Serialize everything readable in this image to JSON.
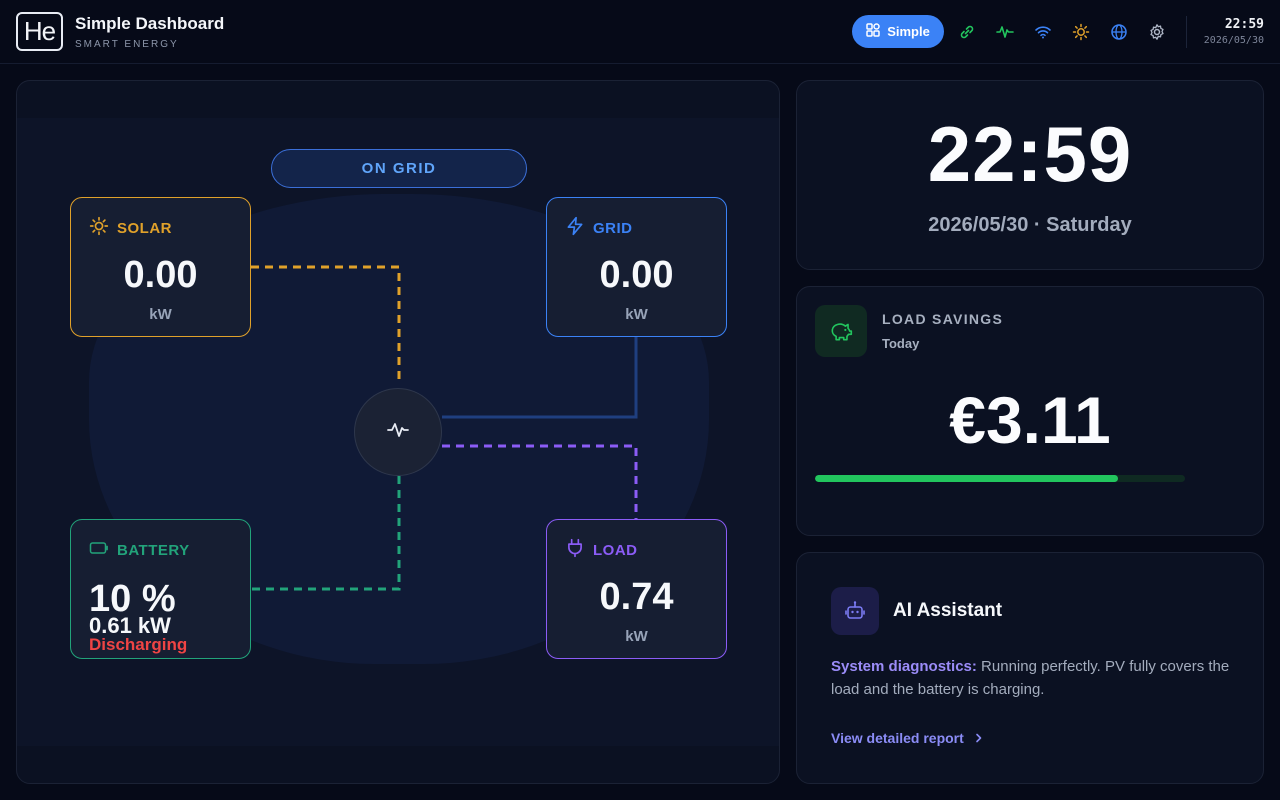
{
  "header": {
    "logo_text": "He",
    "title": "Simple Dashboard",
    "subtitle": "SMART ENERGY",
    "mode_button": "Simple",
    "time": "22:59",
    "date": "2026/05/30",
    "icons": [
      "link-icon",
      "pulse-icon",
      "wifi-icon",
      "sun-icon",
      "globe-icon",
      "gear-icon"
    ]
  },
  "flow": {
    "status": "ON GRID",
    "solar": {
      "label": "SOLAR",
      "value": "0.00",
      "unit": "kW"
    },
    "grid": {
      "label": "GRID",
      "value": "0.00",
      "unit": "kW"
    },
    "battery": {
      "label": "BATTERY",
      "percent": "10 %",
      "power": "0.61 kW",
      "status": "Discharging"
    },
    "load": {
      "label": "LOAD",
      "value": "0.74",
      "unit": "kW"
    }
  },
  "clock": {
    "time": "22:59",
    "date": "2026/05/30 · Saturday"
  },
  "savings": {
    "title": "LOAD SAVINGS",
    "period": "Today",
    "value": "€3.11",
    "progress": 0.82
  },
  "assistant": {
    "title": "AI Assistant",
    "diagnostic_label": "System diagnostics:",
    "diagnostic_text": " Running perfectly. PV fully covers the load and the battery is charging.",
    "link": "View detailed report"
  },
  "colors": {
    "solar": "#e0a12a",
    "grid": "#3b82f6",
    "battery": "#22a37a",
    "load": "#8b5cf6",
    "accent": "#3b82f6",
    "savings": "#22c55e",
    "discharging": "#ef4444"
  }
}
